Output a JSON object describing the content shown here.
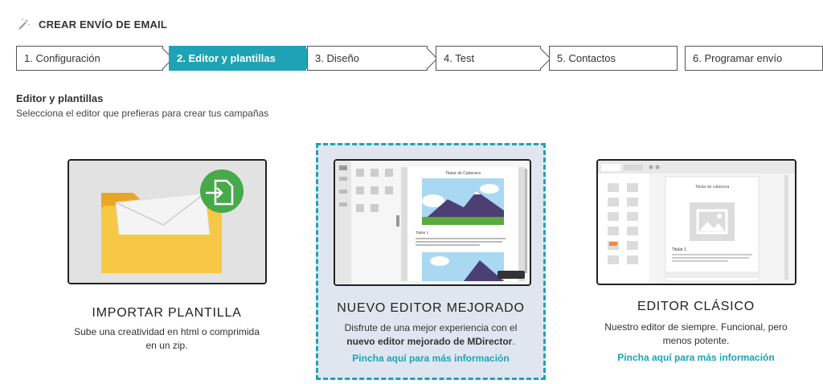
{
  "header": {
    "title": "CREAR ENVÍO DE EMAIL",
    "icon": "magic-wand-icon"
  },
  "steps": [
    {
      "label": "1. Configuración",
      "active": false
    },
    {
      "label": "2. Editor y plantillas",
      "active": true
    },
    {
      "label": "3. Diseño",
      "active": false
    },
    {
      "label": "4. Test",
      "active": false
    },
    {
      "label": "5. Contactos",
      "active": false
    },
    {
      "label": "6. Programar envío",
      "active": false
    }
  ],
  "section": {
    "title": "Editor y plantillas",
    "subtitle": "Selecciona el editor que prefieras para crear tus campañas"
  },
  "options": {
    "import": {
      "title": "IMPORTAR PLANTILLA",
      "description": "Sube una creatividad en html o comprimida en un zip."
    },
    "new_editor": {
      "title": "NUEVO EDITOR MEJORADO",
      "description_part1": "Disfrute de una mejor experiencia con el",
      "description_bold": "nuevo editor mejorado de MDirector",
      "description_end": ".",
      "link": "Pincha aquí para más información",
      "preview_header": "Titular de Cabecera",
      "preview_heading": "Titular 1"
    },
    "classic": {
      "title": "EDITOR CLÁSICO",
      "description": "Nuestro editor de siempre. Funcional, pero menos potente.",
      "link": "Pincha aquí para más información",
      "preview_header": "Titular de cabecera",
      "preview_heading": "Titular 1"
    }
  },
  "colors": {
    "accent": "#1da3b4",
    "selected_bg": "#dfe6f0",
    "folder": "#f7c845",
    "folder_dark": "#e8a825",
    "import_badge": "#46a94a"
  }
}
